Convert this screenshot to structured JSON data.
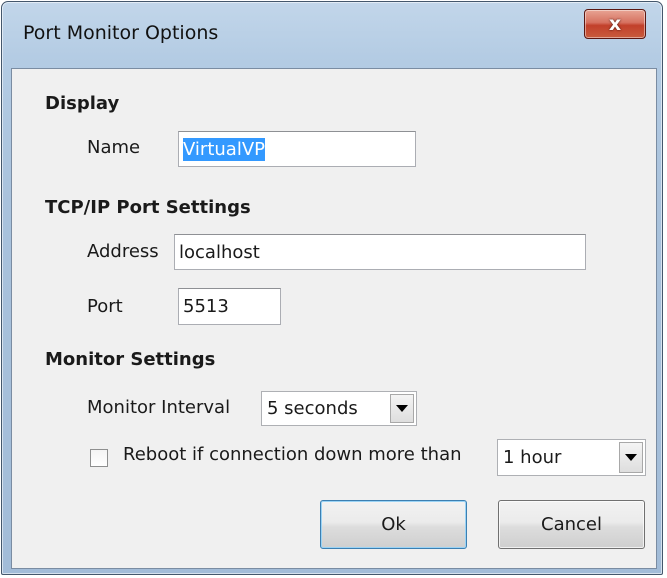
{
  "window": {
    "title": "Port Monitor Options",
    "close_glyph": "x"
  },
  "display": {
    "heading": "Display",
    "name_label": "Name",
    "name_value": "VirtualVP"
  },
  "tcpip": {
    "heading": "TCP/IP Port Settings",
    "address_label": "Address",
    "address_value": "localhost",
    "port_label": "Port",
    "port_value": "5513"
  },
  "monitor": {
    "heading": "Monitor Settings",
    "interval_label": "Monitor Interval",
    "interval_value": "5 seconds",
    "reboot_label": "Reboot if connection down more than",
    "reboot_checked": false,
    "reboot_value": "1 hour"
  },
  "buttons": {
    "ok_label": "Ok",
    "cancel_label": "Cancel"
  },
  "colors": {
    "selection": "#3399ff",
    "close_button": "#c2402b",
    "frame": "#a9c2dc"
  }
}
